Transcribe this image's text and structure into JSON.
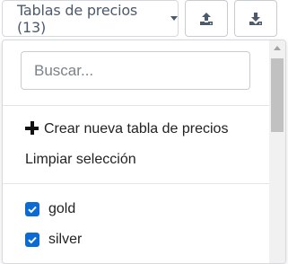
{
  "toolbar": {
    "price_tables_label": "Tablas de precios (13)",
    "upload_icon": "upload-icon",
    "download_icon": "download-icon"
  },
  "dropdown": {
    "search": {
      "placeholder": "Buscar...",
      "value": ""
    },
    "create_label": "Crear nueva tabla de precios",
    "create_icon": "plus-icon",
    "clear_label": "Limpiar selección",
    "items": [
      {
        "label": "gold",
        "checked": true
      },
      {
        "label": "silver",
        "checked": true
      }
    ]
  },
  "colors": {
    "checkbox": "#0b6bd3",
    "button_text": "#4b5a6c",
    "border": "#c8ccd0"
  }
}
